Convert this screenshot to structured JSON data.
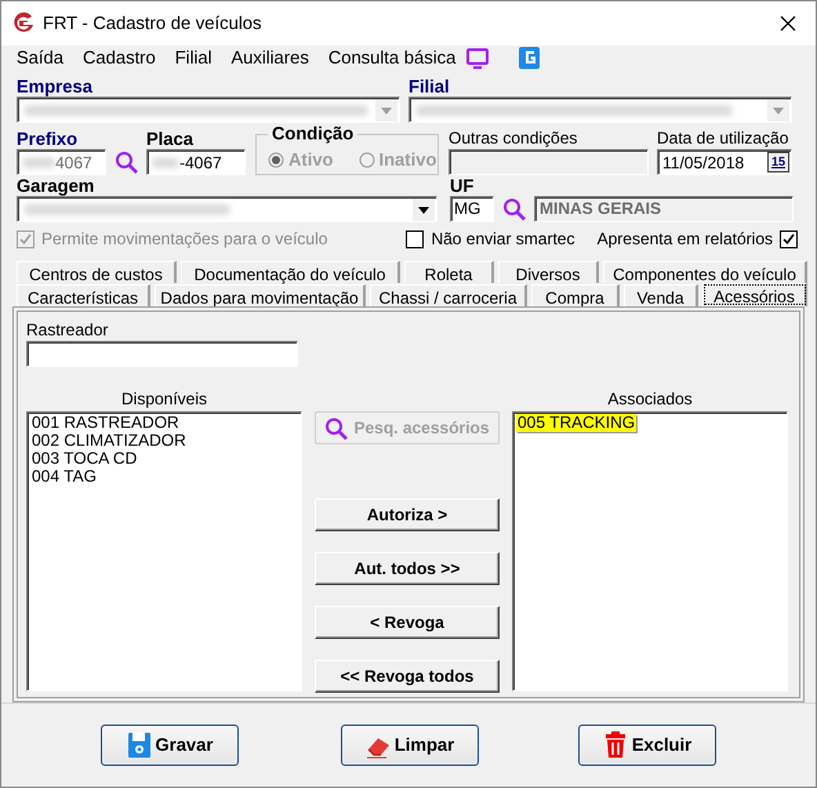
{
  "window": {
    "title": "FRT - Cadastro de veículos"
  },
  "menu": [
    "Saída",
    "Cadastro",
    "Filial",
    "Auxiliares",
    "Consulta básica"
  ],
  "empresa": {
    "label": "Empresa",
    "required": true
  },
  "filial": {
    "label": "Filial",
    "required": true
  },
  "prefixo": {
    "label": "Prefixo",
    "required": true,
    "value": "4067"
  },
  "placa": {
    "label": "Placa",
    "required": false,
    "value": "-4067"
  },
  "condicao": {
    "label": "Condição",
    "disabled": true,
    "options": [
      {
        "label": "Ativo",
        "selected": true
      },
      {
        "label": "Inativo",
        "selected": false
      }
    ]
  },
  "outras_condicoes": {
    "label": "Outras condições"
  },
  "data_utilizacao": {
    "label": "Data de utilização",
    "value": "11/05/2018",
    "calendar_button": "15"
  },
  "garagem": {
    "label": "Garagem",
    "required": false
  },
  "uf": {
    "label": "UF",
    "required": false,
    "value": "MG",
    "state_name": "MINAS GERAIS"
  },
  "checkboxes": [
    {
      "label": "Permite movimentações para o veículo",
      "checked": true,
      "disabled": true
    },
    {
      "label": "Não enviar smartec",
      "checked": false,
      "disabled": false
    },
    {
      "label": "Apresenta em relatórios",
      "checked": true,
      "disabled": false
    }
  ],
  "tabs_row_1": [
    {
      "label": "Centros de custos",
      "selected": false
    },
    {
      "label": "Documentação do veículo",
      "selected": false
    },
    {
      "label": "Roleta",
      "selected": false
    },
    {
      "label": "Diversos",
      "selected": false
    },
    {
      "label": "Componentes do veículo",
      "selected": false
    }
  ],
  "tabs_row_2": [
    {
      "label": "Características",
      "selected": false
    },
    {
      "label": "Dados para movimentação",
      "selected": false
    },
    {
      "label": "Chassi / carroceria",
      "selected": false
    },
    {
      "label": "Compra",
      "selected": false
    },
    {
      "label": "Venda",
      "selected": false
    },
    {
      "label": "Acessórios",
      "selected": true
    }
  ],
  "rastreador": {
    "label": "Rastreador"
  },
  "disponiveis": {
    "label": "Disponíveis",
    "items": [
      {
        "text": "001 RASTREADOR",
        "selected": false
      },
      {
        "text": "002 CLIMATIZADOR",
        "selected": false
      },
      {
        "text": "003 TOCA CD",
        "selected": false
      },
      {
        "text": "004 TAG",
        "selected": false
      }
    ]
  },
  "search_button": {
    "label": "Pesq. acessórios",
    "disabled": true
  },
  "transfer_buttons": [
    "Autoriza >",
    "Aut. todos >>",
    "< Revoga",
    "<< Revoga todos"
  ],
  "associados": {
    "label": "Associados",
    "items": [
      {
        "text": "005 TRACKING",
        "selected": true
      }
    ]
  },
  "footer_buttons": [
    {
      "label": "Gravar",
      "kind": "save"
    },
    {
      "label": "Limpar",
      "kind": "clear"
    },
    {
      "label": "Excluir",
      "kind": "delete"
    }
  ]
}
